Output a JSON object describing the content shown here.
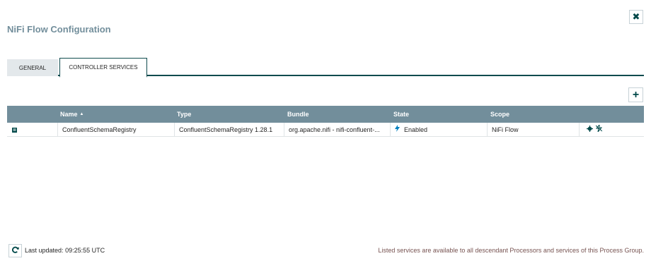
{
  "dialog": {
    "title": "NiFi Flow Configuration",
    "close_icon": "✖"
  },
  "tabs": [
    {
      "label": "GENERAL"
    },
    {
      "label": "CONTROLLER SERVICES"
    }
  ],
  "toolbar": {
    "add_icon": "+"
  },
  "table": {
    "headers": [
      "",
      "Name",
      "Type",
      "Bundle",
      "State",
      "Scope",
      ""
    ],
    "sort_indicator": "▲",
    "rows": [
      {
        "name": "ConfluentSchemaRegistry",
        "type": "ConfluentSchemaRegistry 1.28.1",
        "bundle": "org.apache.nifi - nifi-confluent-...",
        "state": "Enabled",
        "scope": "NiFi Flow"
      }
    ]
  },
  "footer": {
    "last_updated_label": "Last updated:",
    "last_updated_time": "09:25:55 UTC",
    "note": "Listed services are available to all descendant Processors and services of this Process Group."
  },
  "icons": {
    "details": "book-icon",
    "state": "bolt-icon",
    "configure": "gear-icon",
    "disable": "disable-icon",
    "refresh": "refresh-icon"
  }
}
